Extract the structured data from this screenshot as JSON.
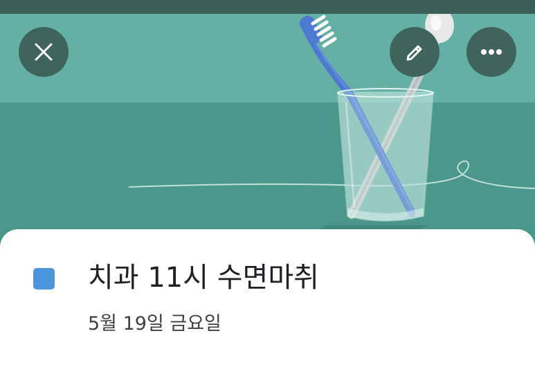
{
  "event": {
    "title": "치과 11시 수면마취",
    "date": "5월 19일 금요일",
    "color": "#4a97de"
  },
  "actions": {
    "close_icon": "close-icon",
    "edit_icon": "pencil-icon",
    "more_icon": "more-horizontal-icon"
  },
  "header_illustration": {
    "subject": "toothbrush-and-dental-mirror-in-glass"
  },
  "colors": {
    "header_teal": "#64b0a4",
    "header_teal_dark": "#4b978b",
    "button_bg": "#3f645b"
  }
}
